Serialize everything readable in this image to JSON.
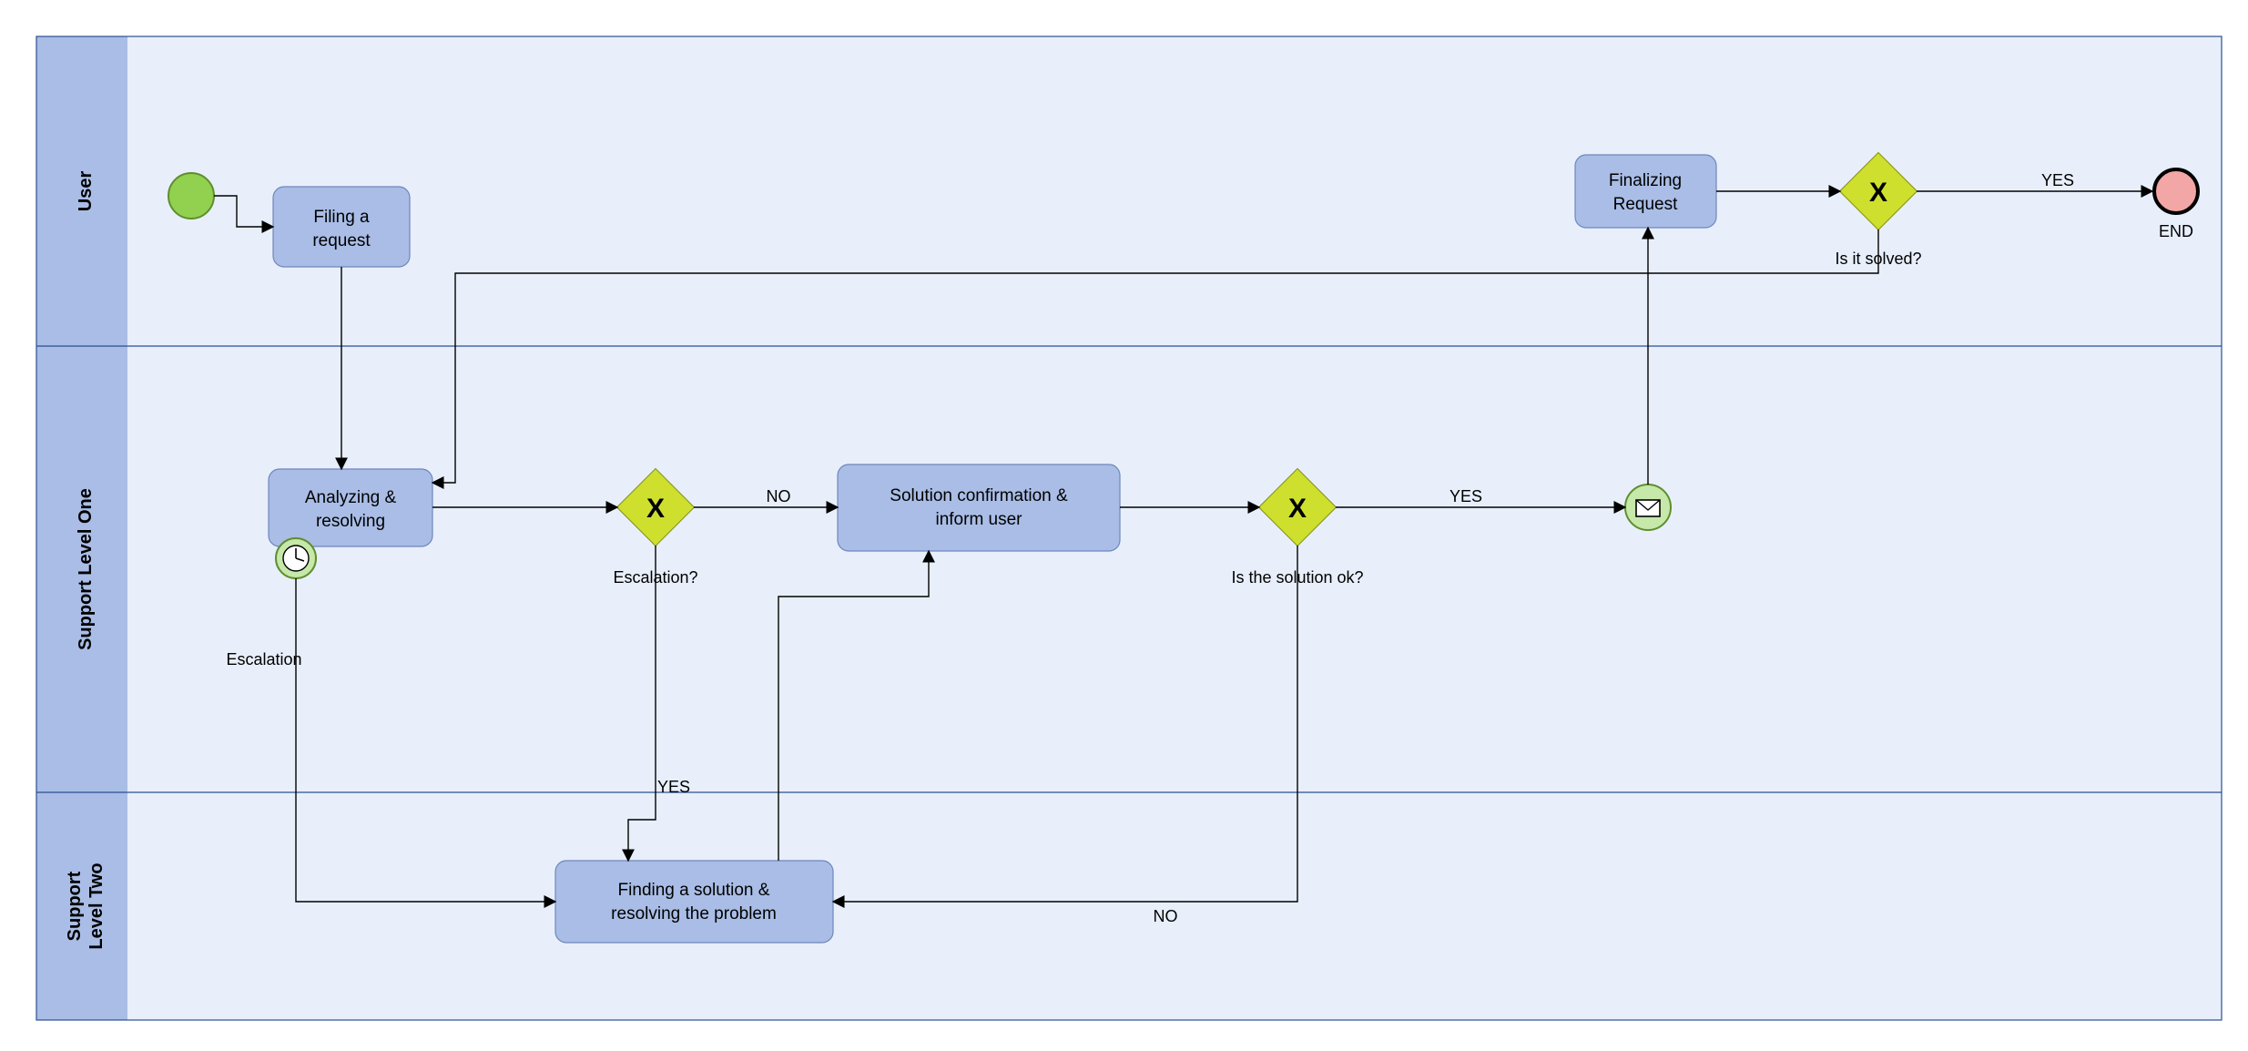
{
  "lanes": {
    "user": "User",
    "l1": "Support Level One",
    "l2_a": "Support",
    "l2_b": "Level Two"
  },
  "tasks": {
    "filing": {
      "l1": "Filing a",
      "l2": "request"
    },
    "analyze": {
      "l1": "Analyzing &",
      "l2": "resolving"
    },
    "solution": {
      "l1": "Solution confirmation &",
      "l2": "inform user"
    },
    "find": {
      "l1": "Finding a solution &",
      "l2": "resolving the problem"
    },
    "finalize": {
      "l1": "Finalizing",
      "l2": "Request"
    }
  },
  "gateways": {
    "escalation": "Escalation?",
    "solok": "Is the solution ok?",
    "solved": "Is it solved?"
  },
  "timer_label": "Escalation",
  "edge_labels": {
    "no": "NO",
    "yes": "YES",
    "end": "END"
  }
}
